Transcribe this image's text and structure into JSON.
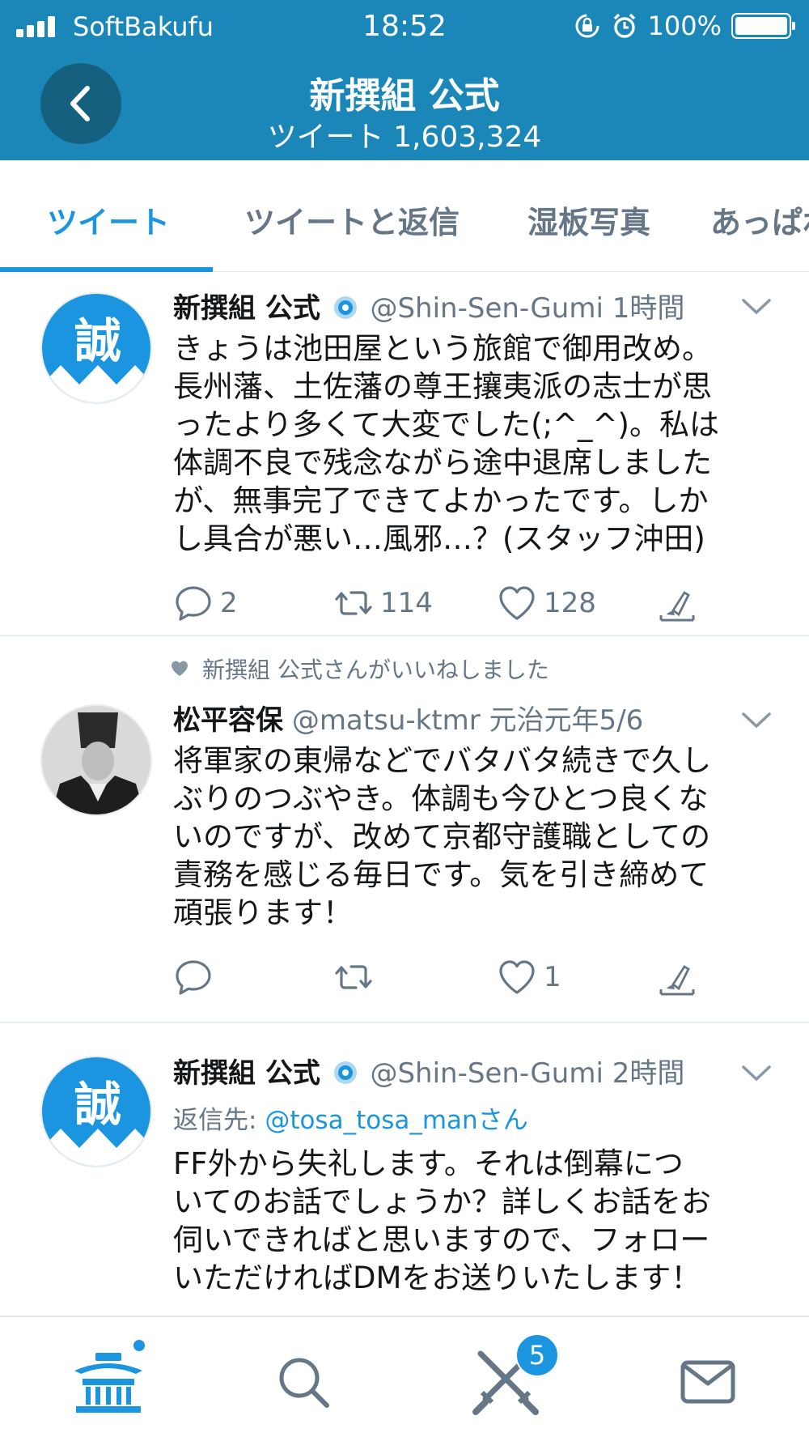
{
  "status": {
    "carrier": "SoftBakufu",
    "time": "18:52",
    "battery": "100%"
  },
  "header": {
    "title": "新撰組 公式",
    "subtitle": "ツイート 1,603,324"
  },
  "tabs": [
    {
      "label": "ツイート",
      "active": true
    },
    {
      "label": "ツイートと返信",
      "active": false
    },
    {
      "label": "湿板写真",
      "active": false
    },
    {
      "label": "あっぱれ",
      "active": false
    }
  ],
  "tweets": [
    {
      "name": "新撰組 公式",
      "handle": "@Shin-Sen-Gumi",
      "time": "1時間",
      "avatar_char": "誠",
      "body": "きょうは池田屋という旅館で御用改め。\n長州藩、土佐藩の尊王攘夷派の志士が思\nったより多くて大変でした(;^_^)。私は\n体調不良で残念ながら途中退席しました\nが、無事完了できてよかったです。しか\nし具合が悪い…風邪…？(スタッフ沖田)",
      "replies": "2",
      "retweets": "114",
      "likes": "128"
    },
    {
      "liked_by": "新撰組 公式さんがいいねしました",
      "name": "松平容保",
      "handle": "@matsu-ktmr",
      "time": "元治元年5/6",
      "body": "将軍家の東帰などでバタバタ続きで久し\nぶりのつぶやき。体調も今ひとつ良くな\nいのですが、改めて京都守護職としての\n責務を感じる毎日です。気を引き締めて\n頑張ります！",
      "replies": "",
      "retweets": "",
      "likes": "1"
    },
    {
      "name": "新撰組 公式",
      "handle": "@Shin-Sen-Gumi",
      "time": "2時間",
      "avatar_char": "誠",
      "reply_prefix": "返信先: ",
      "reply_handle": "@tosa_tosa_manさん",
      "body": "FF外から失礼します。それは倒幕につ\nいてのお話でしょうか？詳しくお話をお\n伺いできればと思いますので、フォロー\nいただければDMをお送りいたします！"
    }
  ],
  "nav": {
    "notifications_badge": "5"
  },
  "colors": {
    "header_bg": "#1b87b8",
    "accent": "#1b95e0",
    "muted": "#657786"
  }
}
